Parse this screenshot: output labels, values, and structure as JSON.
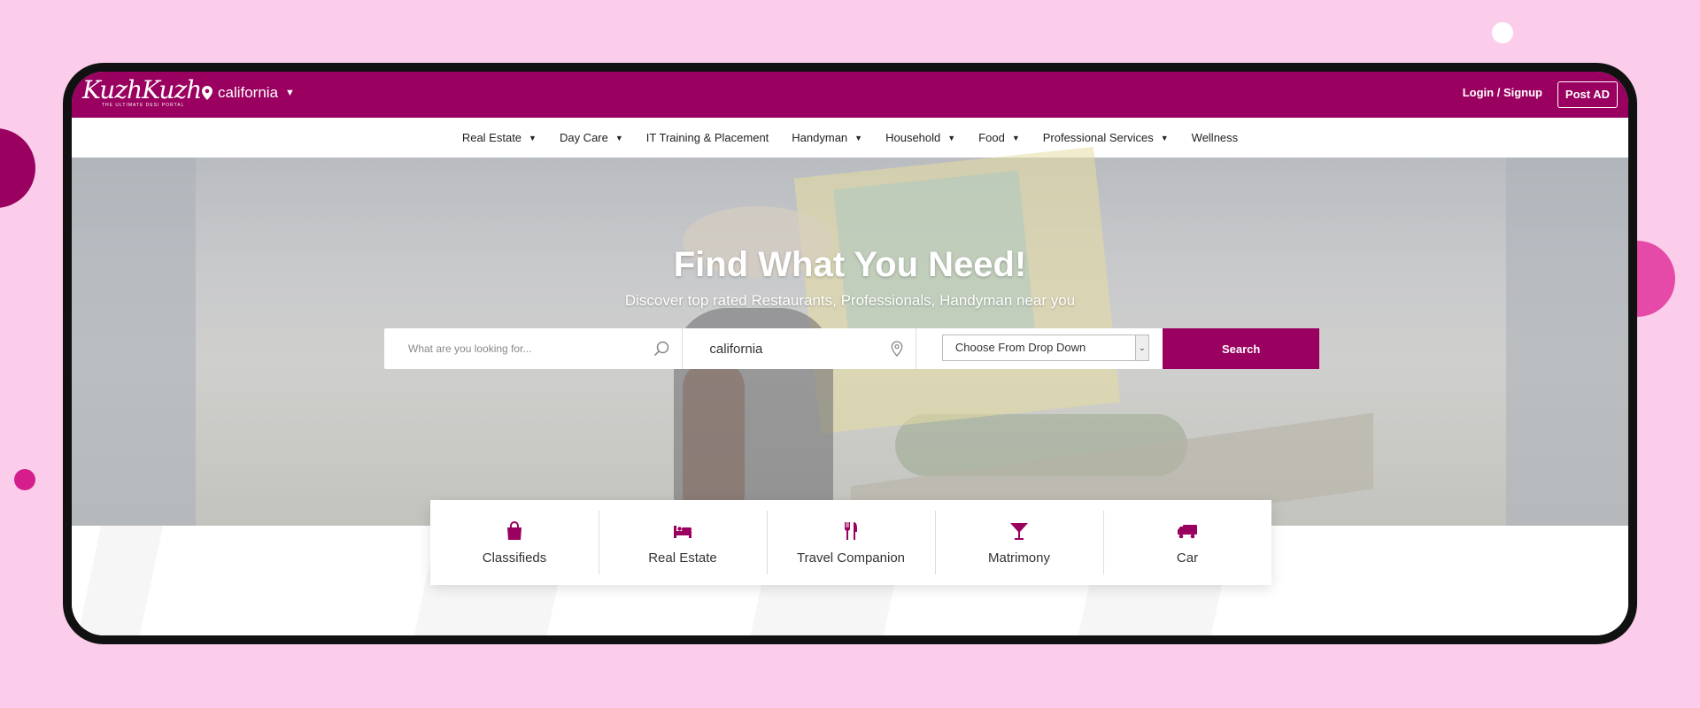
{
  "header": {
    "logo": {
      "name": "KuzhKuzh",
      "tagline": "THE ULTIMATE DESI PORTAL"
    },
    "location": "california",
    "login_label": "Login / Signup",
    "post_ad_label": "Post AD"
  },
  "nav": {
    "items": [
      {
        "label": "Real Estate",
        "dropdown": true
      },
      {
        "label": "Day Care",
        "dropdown": true
      },
      {
        "label": "IT Training & Placement",
        "dropdown": false
      },
      {
        "label": "Handyman",
        "dropdown": true
      },
      {
        "label": "Household",
        "dropdown": true
      },
      {
        "label": "Food",
        "dropdown": true
      },
      {
        "label": "Professional Services",
        "dropdown": true
      },
      {
        "label": "Wellness",
        "dropdown": false
      }
    ]
  },
  "hero": {
    "title": "Find What You Need!",
    "subtitle": "Discover top rated Restaurants, Professionals, Handyman near you"
  },
  "search": {
    "query_placeholder": "What are you looking for...",
    "location_value": "california",
    "category_select": "Choose From Drop Down",
    "button_label": "Search"
  },
  "categories": [
    {
      "label": "Classifieds",
      "icon": "shopping-bag-icon"
    },
    {
      "label": "Real Estate",
      "icon": "bed-icon"
    },
    {
      "label": "Travel Companion",
      "icon": "fork-knife-icon"
    },
    {
      "label": "Matrimony",
      "icon": "cocktail-glass-icon"
    },
    {
      "label": "Car",
      "icon": "truck-icon"
    }
  ],
  "colors": {
    "brand": "#99005f",
    "page_background": "#fbcdea",
    "accent_pink": "#e64aa8"
  }
}
